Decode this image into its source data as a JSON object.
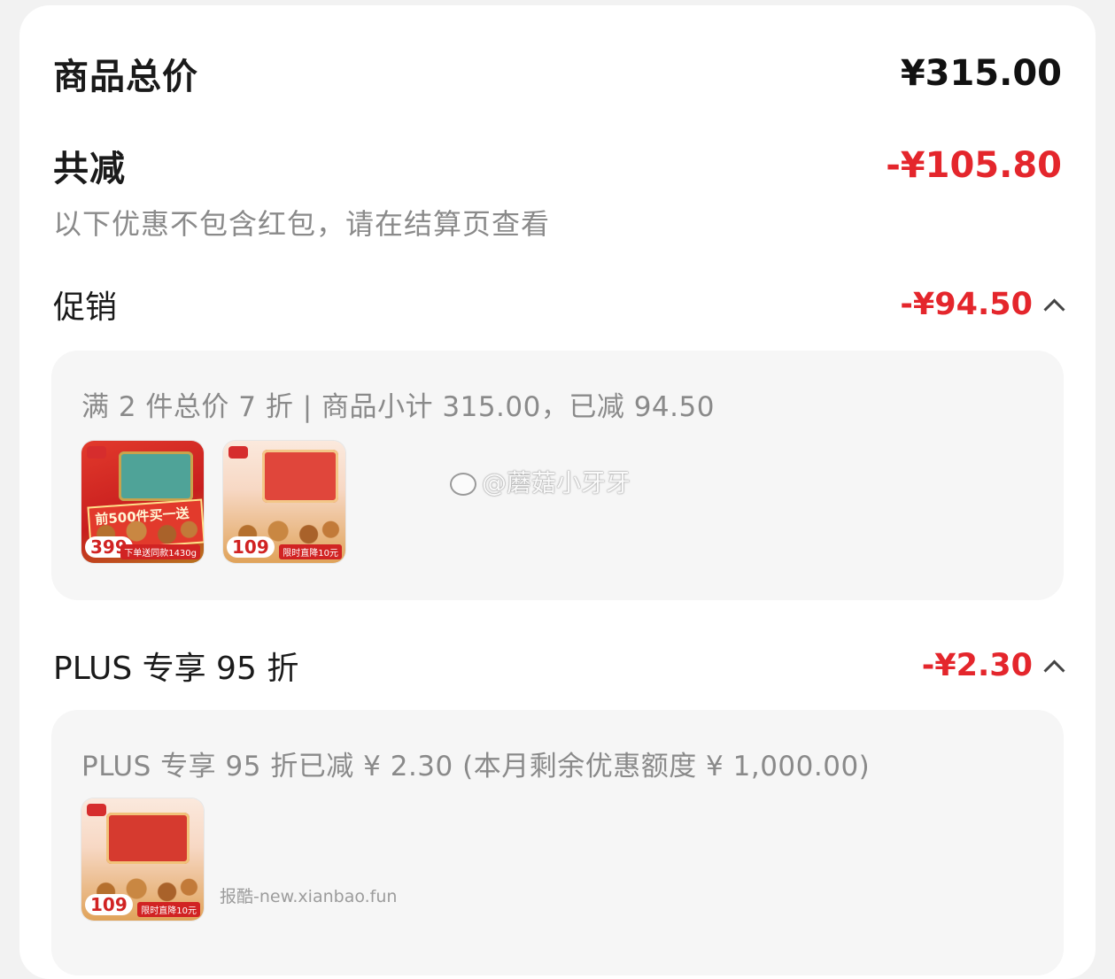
{
  "summary": {
    "total_label": "商品总价",
    "total_value": "¥315.00",
    "reduce_label": "共减",
    "reduce_value": "-¥105.80",
    "note": "以下优惠不包含红包，请在结算页查看"
  },
  "promo": {
    "title": "促销",
    "amount": "-¥94.50",
    "detail": "满 2 件总价 7 折 | 商品小计 315.00，已减 94.50",
    "products": [
      {
        "price_tag": "399",
        "banner": "前500件买一送一",
        "strip": "下单送同款1430g"
      },
      {
        "price_tag": "109",
        "strip": "限时直降10元"
      }
    ]
  },
  "plus": {
    "title": "PLUS 专享 95 折",
    "amount": "-¥2.30",
    "detail": "PLUS 专享 95 折已减 ¥ 2.30 (本月剩余优惠额度 ¥ 1,000.00)",
    "products": [
      {
        "price_tag": "109",
        "strip": "限时直降10元"
      }
    ]
  },
  "watermarks": {
    "weibo": "@蘑菇小牙牙",
    "site": "报酷-new.xianbao.fun"
  },
  "colors": {
    "accent_red": "#e4262c",
    "panel_bg": "#f6f6f6",
    "muted_text": "#8a8a8a"
  }
}
